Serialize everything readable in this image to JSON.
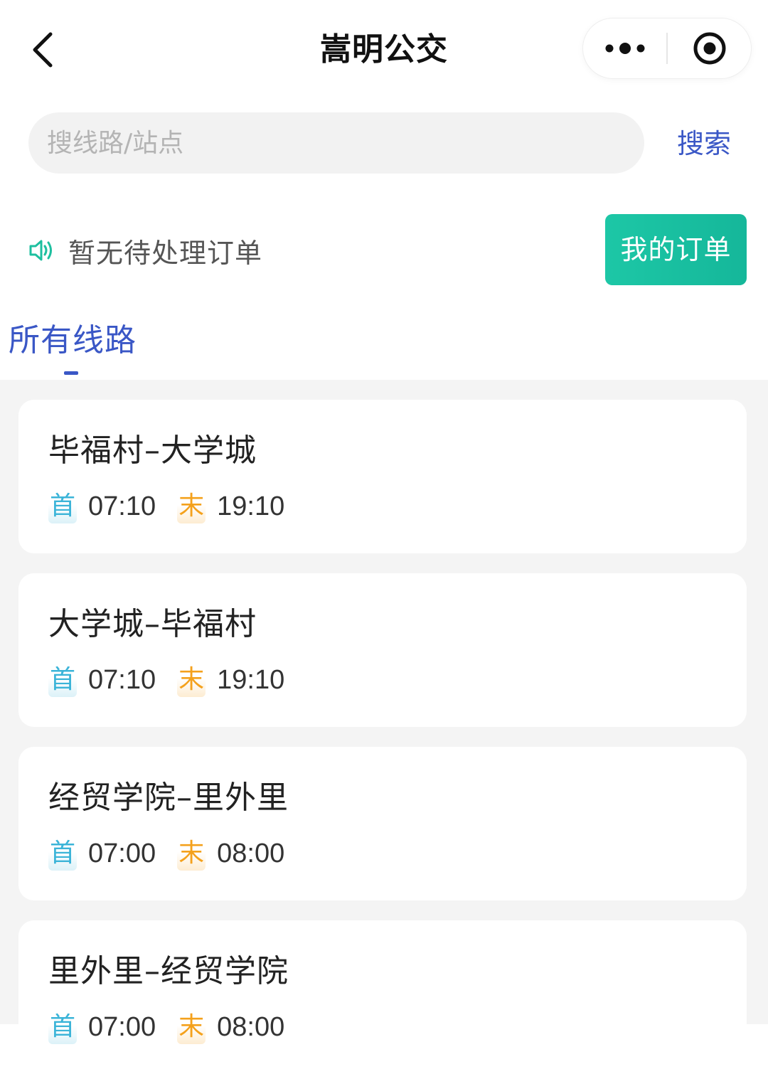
{
  "header": {
    "title": "嵩明公交"
  },
  "search": {
    "placeholder": "搜线路/站点",
    "button_label": "搜索"
  },
  "notice": {
    "text": "暂无待处理订单"
  },
  "orders_button": {
    "label": "我的订单"
  },
  "tabs": [
    {
      "label": "所有线路",
      "active": true
    }
  ],
  "routes": [
    {
      "name": "毕福村–大学城",
      "first_label": "首",
      "first_time": "07:10",
      "last_label": "末",
      "last_time": "19:10"
    },
    {
      "name": "大学城–毕福村",
      "first_label": "首",
      "first_time": "07:10",
      "last_label": "末",
      "last_time": "19:10"
    },
    {
      "name": "经贸学院–里外里",
      "first_label": "首",
      "first_time": "07:00",
      "last_label": "末",
      "last_time": "08:00"
    },
    {
      "name": "里外里–经贸学院",
      "first_label": "首",
      "first_time": "07:00",
      "last_label": "末",
      "last_time": "08:00"
    }
  ],
  "colors": {
    "accent_blue": "#3a57c6",
    "button_green": "#1dc7a6",
    "first_badge": "#3bb4d8",
    "last_badge": "#f4a11c",
    "list_background": "#f4f4f4"
  },
  "icons": {
    "back": "chevron-left-icon",
    "more": "more-dots-icon",
    "close": "target-circle-icon",
    "notice": "speaker-icon"
  }
}
